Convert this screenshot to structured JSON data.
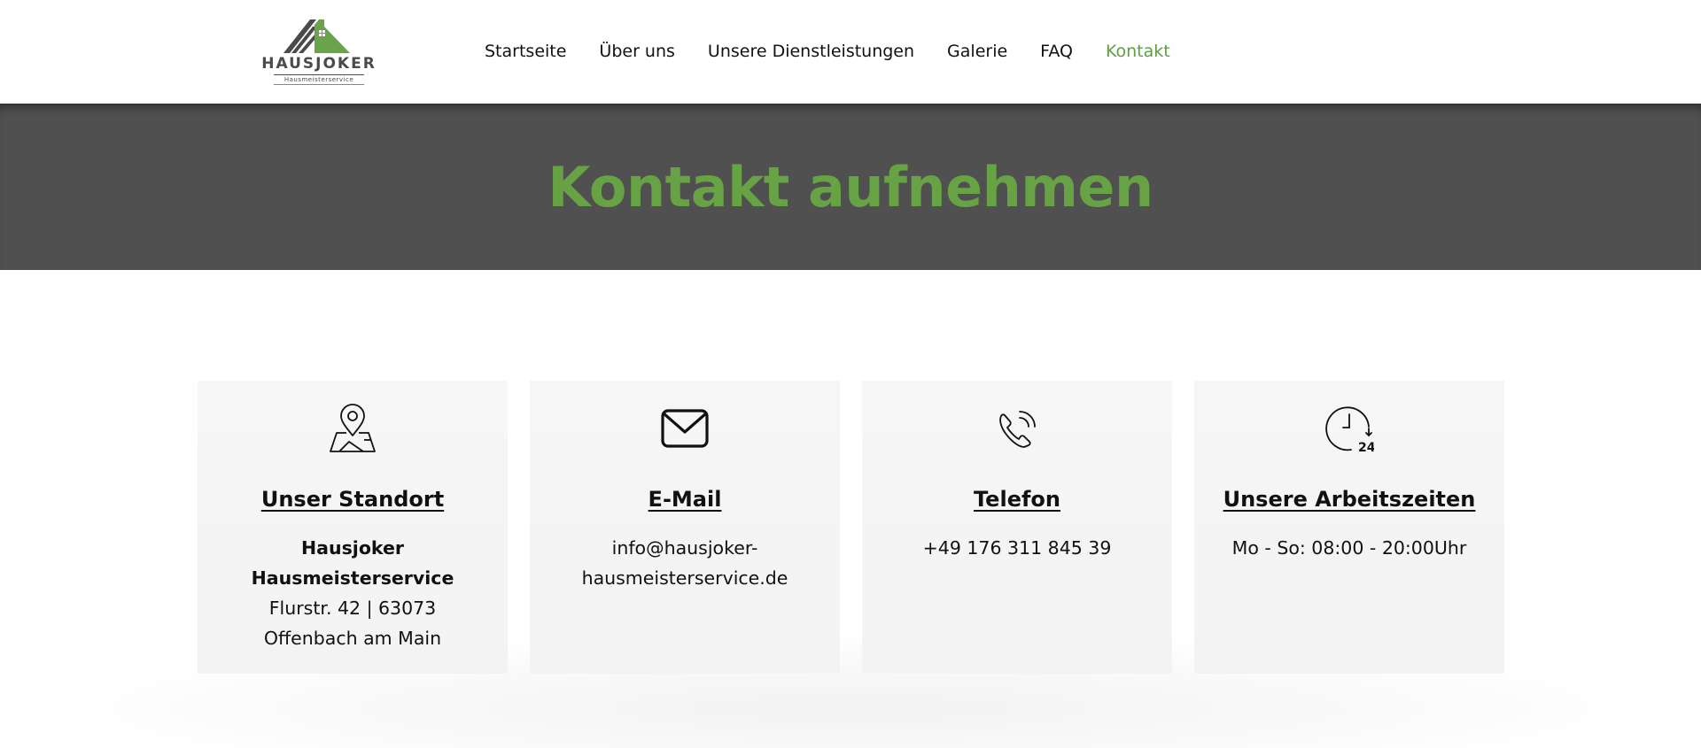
{
  "brand": {
    "name": "HAUSJOKER",
    "tagline": "Hausmeisterservice",
    "colors": {
      "green": "#5e9e3e",
      "heading_green": "#67a345",
      "banner_bg": "#505050",
      "dark_gray": "#4a4a4a"
    }
  },
  "nav": {
    "items": [
      {
        "label": "Startseite"
      },
      {
        "label": "Über uns"
      },
      {
        "label": "Unsere Dienstleistungen"
      },
      {
        "label": "Galerie"
      },
      {
        "label": "FAQ"
      },
      {
        "label": "Kontakt",
        "active": true
      }
    ]
  },
  "banner": {
    "title": "Kontakt aufnehmen"
  },
  "cards": [
    {
      "icon": "map-pin-icon",
      "title": "Unser Standort",
      "lines": [
        "Hausjoker",
        "Hausmeisterservice"
      ],
      "address": "Flurstr. 42 | 63073 Offenbach am Main"
    },
    {
      "icon": "envelope-icon",
      "title": "E-Mail",
      "email": "info@hausjoker-hausmeisterservice.de"
    },
    {
      "icon": "phone-icon",
      "title": "Telefon",
      "phone": "+49 176 311 845 39"
    },
    {
      "icon": "clock-24-icon",
      "title": "Unsere Arbeitszeiten",
      "hours": "Mo - So: 08:00 - 20:00Uhr"
    }
  ]
}
